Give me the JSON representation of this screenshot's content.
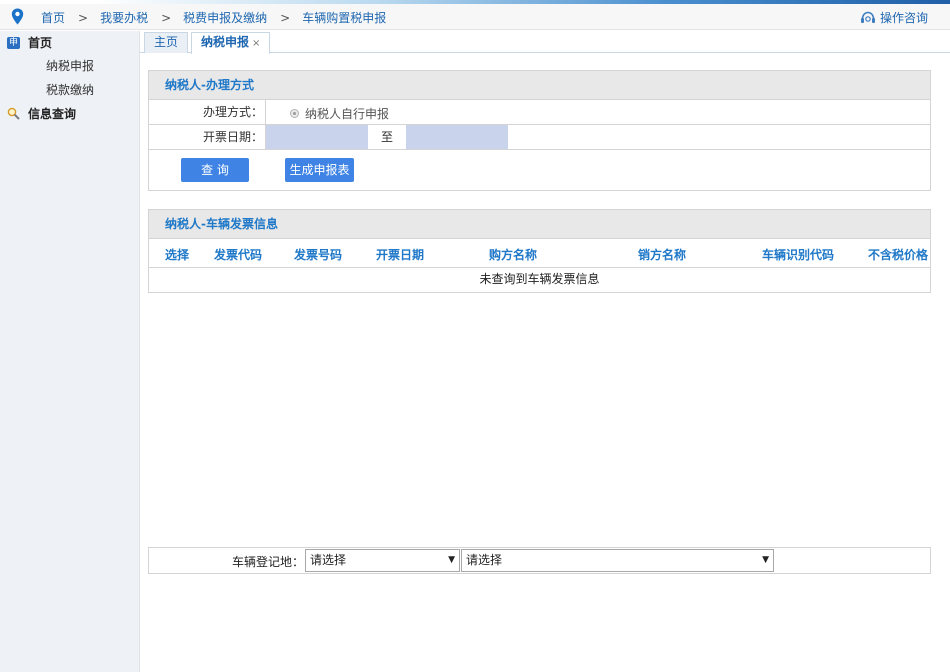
{
  "breadcrumb": [
    "首页",
    "我要办税",
    "税费申报及缴纳",
    "车辆购置税申报"
  ],
  "breadcrumb_sep": ">",
  "help_label": "操作咨询",
  "sidebar": {
    "home": {
      "icon_text": "申",
      "label": "首页"
    },
    "subitems": [
      "纳税申报",
      "税款缴纳"
    ],
    "query": {
      "label": "信息查询"
    }
  },
  "tabs": {
    "home": "主页",
    "active": "纳税申报",
    "close": "×"
  },
  "method_panel": {
    "title": "纳税人-办理方式",
    "method_label": "办理方式：",
    "method_option": "纳税人自行申报",
    "date_label": "开票日期：",
    "date_from": "",
    "date_sep": "至",
    "date_to": "",
    "query_button": "查 询",
    "generate_button": "生成申报表"
  },
  "invoice_panel": {
    "title": "纳税人-车辆发票信息",
    "columns": [
      "选择",
      "发票代码",
      "发票号码",
      "开票日期",
      "购方名称",
      "销方名称",
      "车辆识别代码",
      "不含税价格"
    ],
    "empty_message": "未查询到车辆发票信息"
  },
  "registration": {
    "label": "车辆登记地：",
    "select1": "请选择",
    "select2": "请选择",
    "arrow": "▼"
  },
  "colors": {
    "accent": "#1f78c8",
    "button": "#3f84e5",
    "date_fill": "#c9d4ec"
  }
}
